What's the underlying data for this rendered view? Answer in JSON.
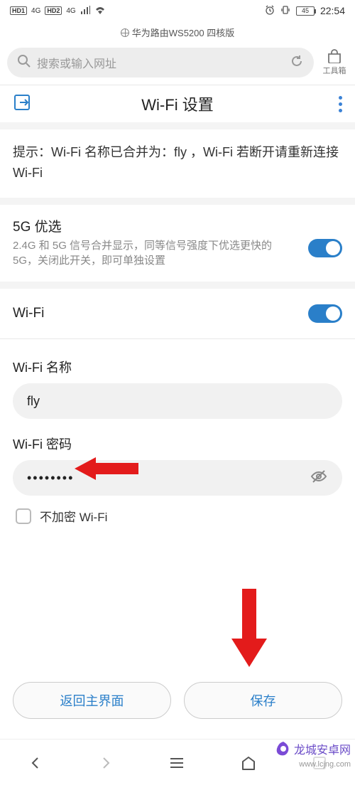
{
  "status": {
    "hd1": "HD1",
    "hd2": "HD2",
    "net1": "4G",
    "net2": "4G",
    "battery": "45",
    "time": "22:54"
  },
  "pageTitle": "华为路由WS5200 四核版",
  "search": {
    "placeholder": "搜索或输入网址"
  },
  "toolbox": "工具箱",
  "appBar": {
    "title": "Wi-Fi 设置"
  },
  "notice": "提示：Wi-Fi 名称已合并为：fly ，Wi-Fi 若断开请重新连接 Wi-Fi",
  "pref5g": {
    "title": "5G 优选",
    "desc": "2.4G 和 5G 信号合并显示，同等信号强度下优选更快的 5G，关闭此开关，即可单独设置"
  },
  "wifiToggleLabel": "Wi-Fi",
  "nameLabel": "Wi-Fi 名称",
  "nameValue": "fly",
  "pwdLabel": "Wi-Fi 密码",
  "pwdValue": "••••••••",
  "noEncrypt": "不加密 Wi-Fi",
  "buttons": {
    "back": "返回主界面",
    "save": "保存"
  },
  "watermark": {
    "text": "龙城安卓网",
    "url": "www.lcjng.com"
  }
}
